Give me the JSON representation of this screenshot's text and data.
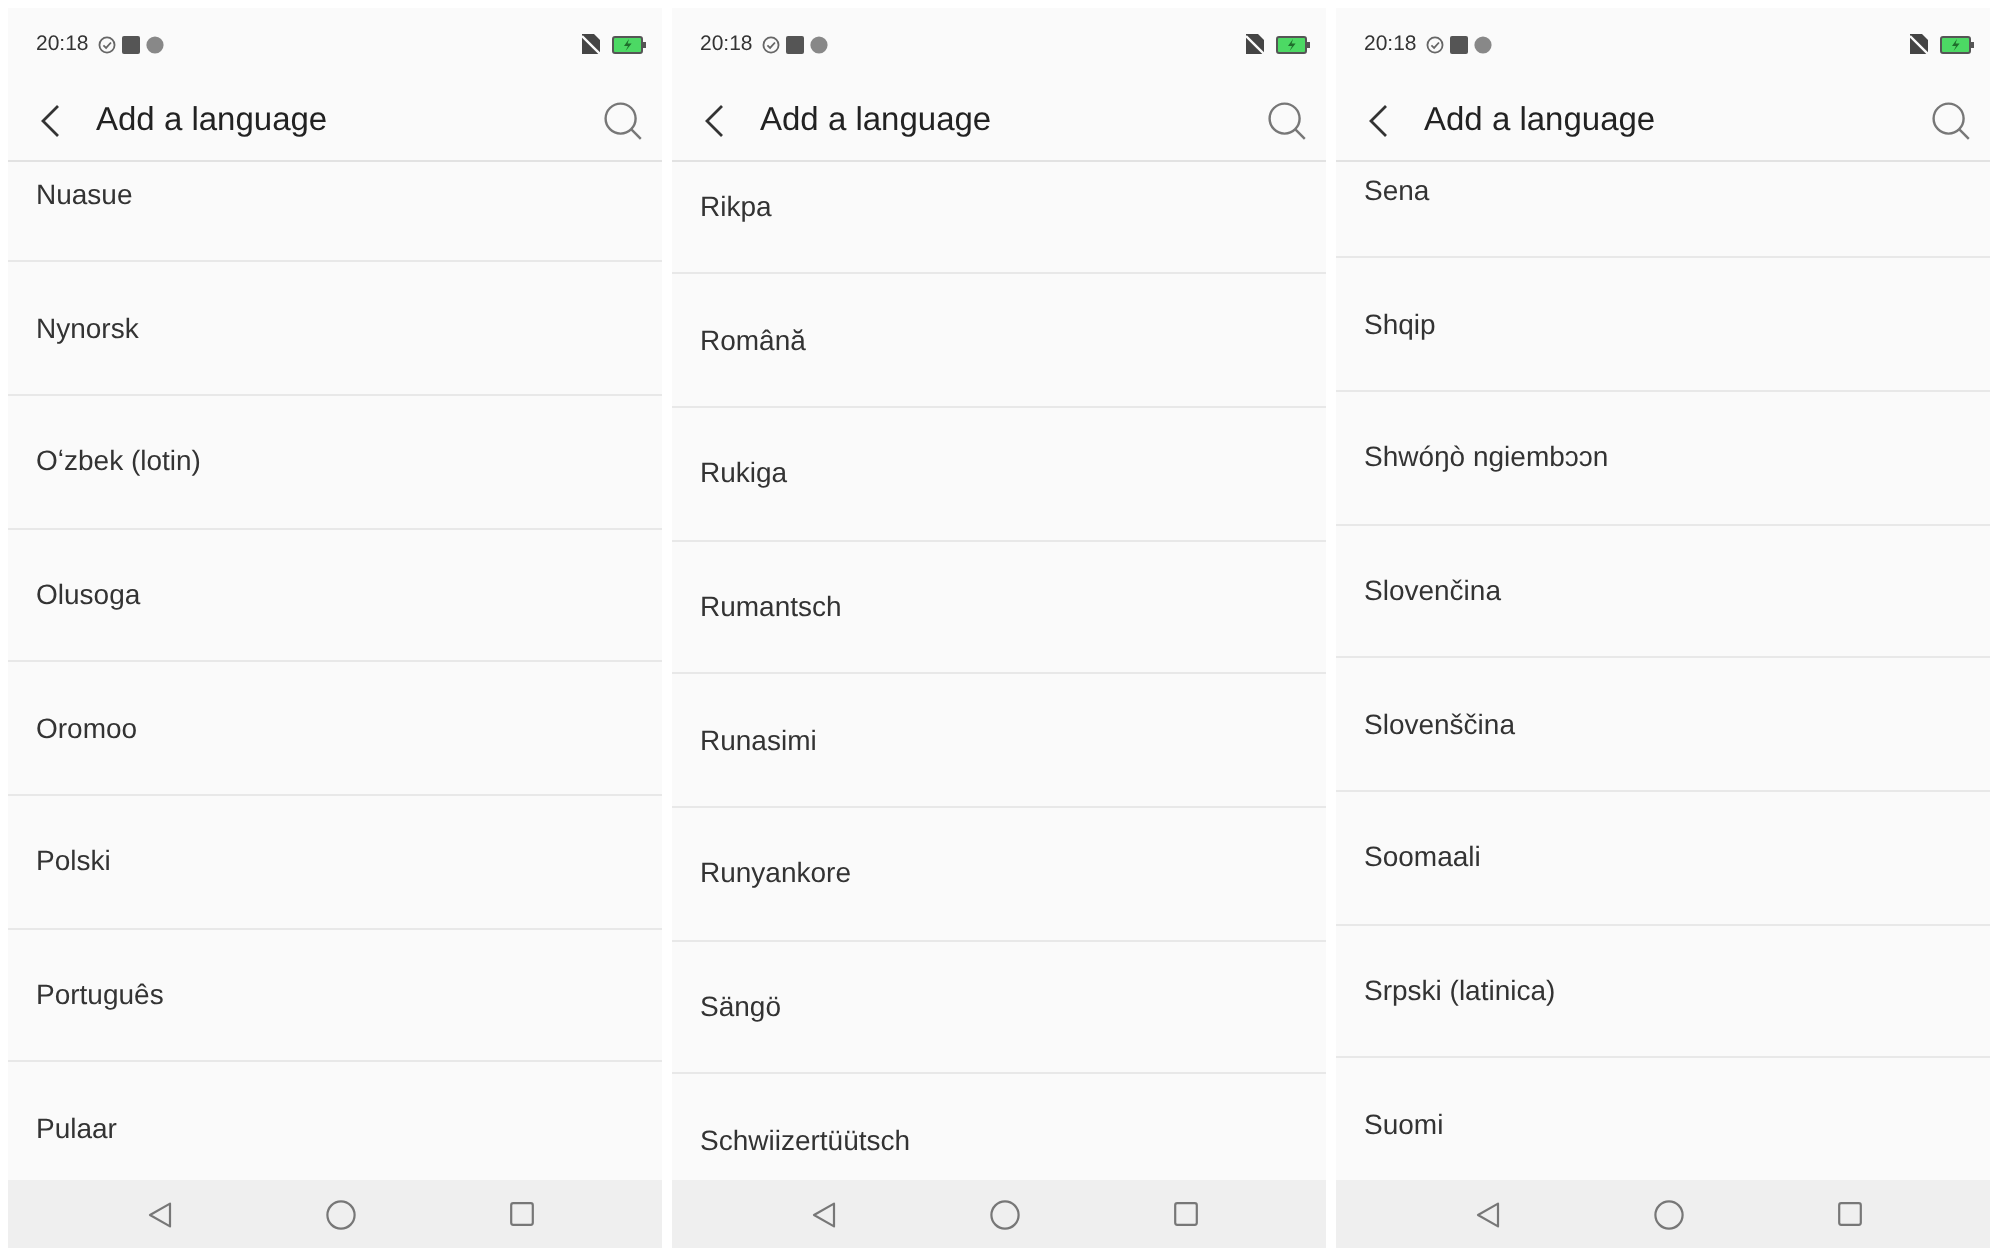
{
  "screens": [
    {
      "status_bar": {
        "time": "20:18"
      },
      "header": {
        "title": "Add a language"
      },
      "languages": [
        "Nuasue",
        "Nynorsk",
        "Oʻzbek (lotin)",
        "Olusoga",
        "Oromoo",
        "Polski",
        "Português",
        "Pulaar"
      ]
    },
    {
      "status_bar": {
        "time": "20:18"
      },
      "header": {
        "title": "Add a language"
      },
      "languages": [
        "Rikpa",
        "Română",
        "Rukiga",
        "Rumantsch",
        "Runasimi",
        "Runyankore",
        "Sängö",
        "Schwiizertüütsch"
      ]
    },
    {
      "status_bar": {
        "time": "20:18"
      },
      "header": {
        "title": "Add a language"
      },
      "languages": [
        "Sena",
        "Shqip",
        "Shwóŋò ngiembɔɔn",
        "Slovenčina",
        "Slovenščina",
        "Soomaali",
        "Srpski (latinica)",
        "Suomi"
      ]
    }
  ]
}
